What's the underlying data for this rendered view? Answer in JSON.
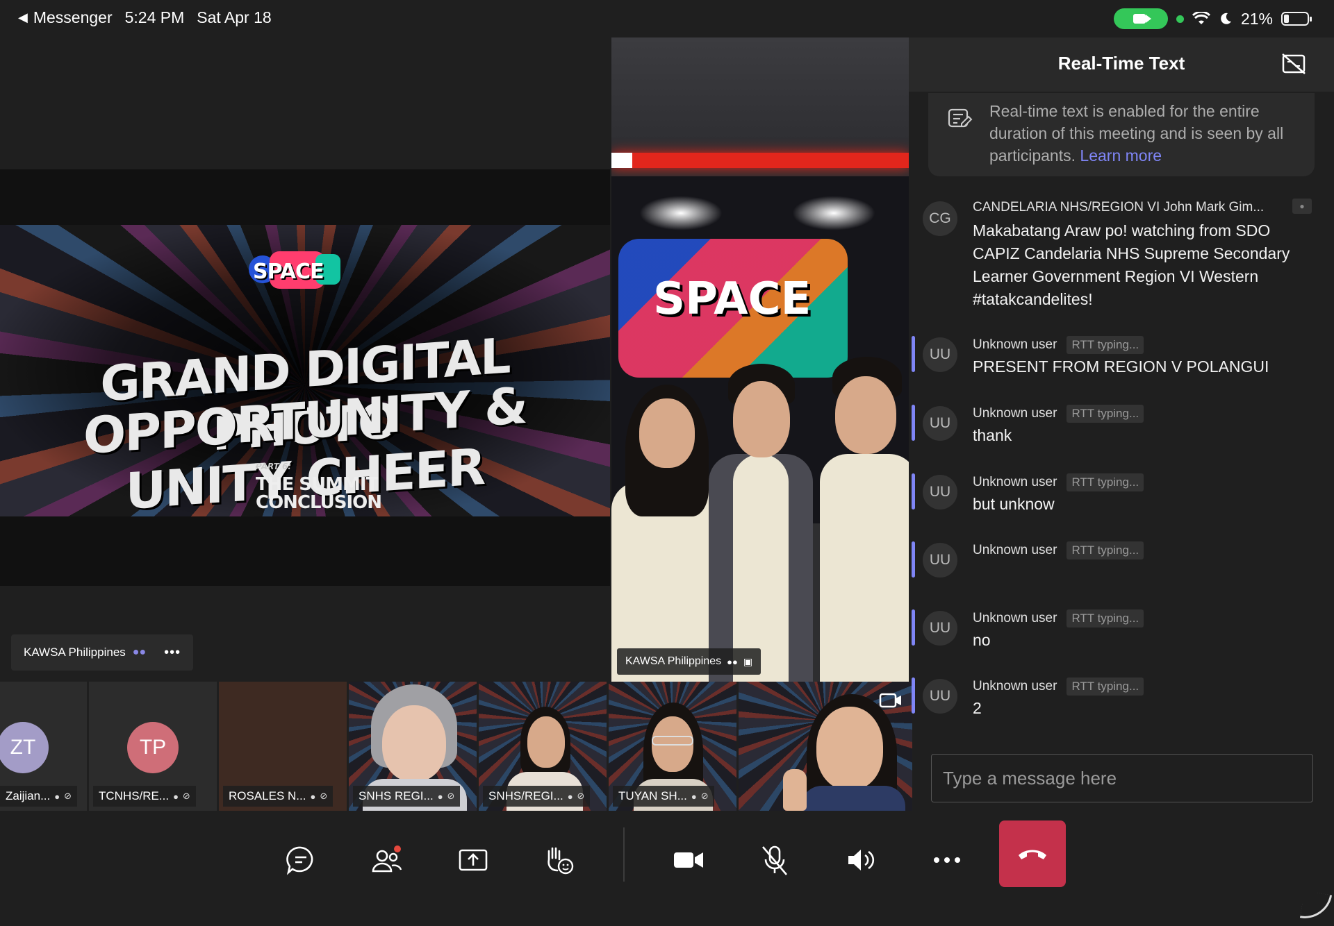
{
  "status_bar": {
    "back_app": "Messenger",
    "time": "5:24 PM",
    "date": "Sat Apr 18",
    "battery": "21%"
  },
  "stage": {
    "slide": {
      "logo_text": "SPACE",
      "title_line1": "GRAND DIGITAL PHOTO",
      "title_line2": "OPPORTUNITY & UNITY CHEER",
      "part_label": "PART 6:",
      "part_line1": "THE SUMMIT",
      "part_line2": "CONCLUSION"
    },
    "presenter_name": "KAWSA Philippines",
    "more_label": "•••"
  },
  "speaker": {
    "logo_text": "SPACE",
    "name": "KAWSA Philippines"
  },
  "thumbnails": [
    {
      "initials": "ZT",
      "label": "Zaijian...",
      "avatar_color": "#a39cc7"
    },
    {
      "initials": "TP",
      "label": "TCNHS/RE...",
      "avatar_color": "#cf6e78"
    },
    {
      "initials": "",
      "label": "ROSALES N..."
    },
    {
      "initials": "",
      "label": "SNHS REGI..."
    },
    {
      "initials": "",
      "label": "SNHS/REGI..."
    },
    {
      "initials": "",
      "label": "TUYAN SH..."
    },
    {
      "initials": "",
      "label": ""
    }
  ],
  "rtt": {
    "title": "Real-Time Text",
    "info_text": "Real-time text is enabled for the entire duration of this meeting and is seen by all participants.",
    "info_link": "Learn more",
    "badge": "RTT typing...",
    "messages": [
      {
        "initials": "CG",
        "sender": "CANDELARIA NHS/REGION VI John Mark Gim...",
        "text": "Makabatang Araw po! watching from SDO CAPIZ Candelaria NHS Supreme Secondary Learner Government Region VI Western #tatakcandelites!"
      },
      {
        "initials": "UU",
        "sender": "Unknown user",
        "text": "PRESENT FROM REGION V POLANGUI"
      },
      {
        "initials": "UU",
        "sender": "Unknown user",
        "text": "thank"
      },
      {
        "initials": "UU",
        "sender": "Unknown user",
        "text": "but unknow"
      },
      {
        "initials": "UU",
        "sender": "Unknown user",
        "text": ""
      },
      {
        "initials": "UU",
        "sender": "Unknown user",
        "text": "no"
      },
      {
        "initials": "UU",
        "sender": "Unknown user",
        "text": "2"
      }
    ],
    "input_placeholder": "Type a message here"
  },
  "colors": {
    "accent": "#7f85f5",
    "hangup": "#c4314b",
    "battery_green": "#34c759"
  }
}
